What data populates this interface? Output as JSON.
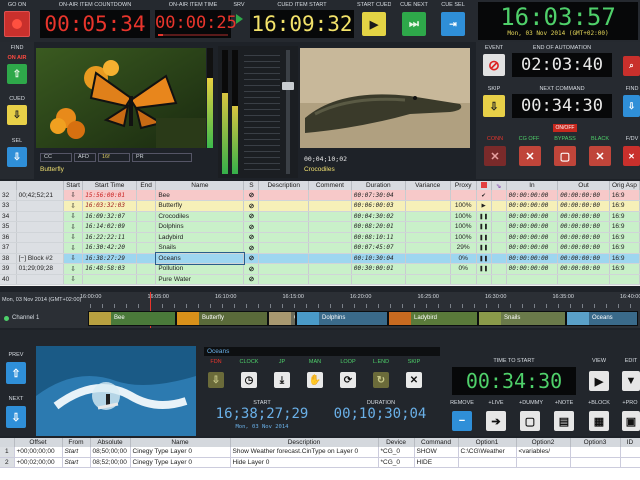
{
  "header": {
    "go_on_label": "GO ON",
    "on_air_countdown_label": "ON-AIR ITEM COUNTDOWN",
    "on_air_countdown_value": "00:05:34",
    "on_air_time_label": "ON-AIR ITEM TIME",
    "on_air_time_value": "00:00:25",
    "srv_label": "SRV",
    "cued_start_label": "CUED ITEM START",
    "cued_start_value": "16:09:32",
    "start_cued_label": "START CUED",
    "cue_next_label": "CUE NEXT",
    "cue_sel_label": "CUE SEL",
    "clock_value": "16:03:57",
    "clock_date": "Mon, 03 Nov 2014 (GMT+02:00)"
  },
  "left_panel": {
    "find_label": "FIND",
    "on_air_label": "ON AIR",
    "cued_label": "CUED",
    "sel_label": "SEL"
  },
  "preview": {
    "onair_caption": "Butterfly",
    "onair_tags": [
      "CC",
      "AFD",
      "16f",
      "PR"
    ],
    "cued_timecode": "00;04;10;02",
    "cued_caption": "Crocodiles"
  },
  "right_panel": {
    "event_label": "EVENT",
    "end_of_automation_label": "END OF AUTOMATION",
    "end_of_automation_value": "02:03:40",
    "skip_label": "SKIP",
    "next_command_label": "NEXT COMMAND",
    "next_command_value": "00:34:30",
    "on_off_label": "ON/OFF",
    "find_label": "FIND",
    "fdv_label": "F/DV",
    "keyers": [
      "CONN",
      "CG OFF",
      "BYPASS",
      "BLACK"
    ]
  },
  "playlist": {
    "columns": [
      "",
      "Start",
      "Start Time",
      "End",
      "Name",
      "S",
      "Description",
      "Comment",
      "Duration",
      "Variance",
      "Proxy",
      "",
      "",
      "In",
      "Out",
      "Orig Asp"
    ],
    "rows": [
      {
        "num": "32",
        "time": "00;42;52;21",
        "start": "⇩",
        "start_time": "15:56:00:01",
        "name": "Bee",
        "duration": "00:07:30:04",
        "variance": "",
        "proxy": "",
        "in": "00:00:00:00",
        "out": "00:00:00:00",
        "asp": "16:9"
      },
      {
        "num": "33",
        "time": "",
        "start": "⇩",
        "start_time": "16:03:32:03",
        "name": "Butterfly",
        "duration": "00:06:00:03",
        "variance": "",
        "proxy": "100%",
        "in": "00:00:00:00",
        "out": "00:00:00:00",
        "asp": "16:9"
      },
      {
        "num": "34",
        "time": "",
        "start": "⇩",
        "start_time": "16:09:32:07",
        "name": "Crocodiles",
        "duration": "00:04:30:02",
        "variance": "",
        "proxy": "100%",
        "in": "00:00:00:00",
        "out": "00:00:00:00",
        "asp": "16:9"
      },
      {
        "num": "35",
        "time": "",
        "start": "⇩",
        "start_time": "16:14:02:09",
        "name": "Dolphins",
        "duration": "00:08:20:01",
        "variance": "",
        "proxy": "100%",
        "in": "00:00:00:00",
        "out": "00:00:00:00",
        "asp": "16:9"
      },
      {
        "num": "36",
        "time": "",
        "start": "⇩",
        "start_time": "16:22:22:11",
        "name": "Ladybird",
        "duration": "00:08:10:11",
        "variance": "",
        "proxy": "100%",
        "in": "00:00:00:00",
        "out": "00:00:00:00",
        "asp": "16:9"
      },
      {
        "num": "37",
        "time": "",
        "start": "⇩",
        "start_time": "16:30:42:20",
        "name": "Snails",
        "duration": "00:07:45:07",
        "variance": "",
        "proxy": "29%",
        "in": "00:00:00:00",
        "out": "00:00:00:00",
        "asp": "16:9"
      },
      {
        "num": "38",
        "time": "[−] Block #2",
        "start": "⇩",
        "start_time": "16:38:27:29",
        "name": "Oceans",
        "duration": "00:10:30:04",
        "variance": "",
        "proxy": "0%",
        "in": "00:00:00:00",
        "out": "00:00:00:00",
        "asp": "16:9"
      },
      {
        "num": "39",
        "time": "01;29;09;28",
        "start": "⇩",
        "start_time": "16:48:58:03",
        "name": "Pollution",
        "duration": "00:30:00:01",
        "variance": "",
        "proxy": "0%",
        "in": "00:00:00:00",
        "out": "00:00:00:00",
        "asp": "16:9"
      },
      {
        "num": "40",
        "time": "",
        "start": "⇩",
        "start_time": "",
        "name": "Pure Water",
        "duration": "",
        "variance": "",
        "proxy": "",
        "in": "",
        "out": "",
        "asp": ""
      }
    ]
  },
  "timeline": {
    "date_label": "Mon, 03 Nov 2014 (GMT+02:00)",
    "ticks": [
      "16:00:00",
      "16:05:00",
      "16:10:00",
      "16:15:00",
      "16:20:00",
      "16:25:00",
      "16:30:00",
      "16:35:00",
      "16:40:00"
    ],
    "channel_label": "Channel 1",
    "clips": [
      "Bee",
      "Butterfly",
      "Croc",
      "Dolphins",
      "Ladybird",
      "Snails",
      "Oceans"
    ]
  },
  "cue_panel": {
    "prev_label": "PREV",
    "next_label": "NEXT",
    "item_name": "Oceans",
    "buttons": [
      "FDN",
      "CLOCK",
      "JP",
      "MAN",
      "LOOP",
      "L.END",
      "SKIP"
    ],
    "start_label": "START",
    "start_value": "16;38;27;29",
    "start_date": "Mon, 03 Nov 2014",
    "duration_label": "DURATION",
    "duration_value": "00;10;30;04",
    "time_to_start_label": "TIME TO START",
    "time_to_start_value": "00:34:30",
    "view_label": "VIEW",
    "edit_label": "EDIT",
    "remove_label": "REMOVE",
    "add_live_label": "+LIVE",
    "add_dummy_label": "+DUMMY",
    "add_note_label": "+NOTE",
    "add_block_label": "+BLOCK",
    "add_pro_label": "+PRO"
  },
  "secondary": {
    "columns": [
      "",
      "Offset",
      "From",
      "Absolute",
      "Name",
      "Description",
      "Device",
      "Command",
      "Option1",
      "Option2",
      "Option3",
      "ID"
    ],
    "rows": [
      {
        "num": "1",
        "offset": "+00;00;00;00",
        "from": "Start",
        "absolute": "08;50;00;00",
        "name": "Cinegy Type Layer 0",
        "description": "Show Weather forecast.CinType on Layer 0",
        "device": "*CG_0",
        "command": "SHOW",
        "option1": "C:\\CG\\Weather",
        "option2": "<variables/",
        "option3": "",
        "id": ""
      },
      {
        "num": "2",
        "offset": "+00;02;00;00",
        "from": "Start",
        "absolute": "08;52;00;00",
        "name": "Cinegy Type Layer 0",
        "description": "Hide Layer 0",
        "device": "*CG_0",
        "command": "HIDE",
        "option1": "",
        "option2": "",
        "option3": "",
        "id": ""
      }
    ]
  },
  "colors": {
    "accent_red": "#e8352c",
    "accent_green": "#2ea84a",
    "accent_yellow": "#e4d445",
    "accent_blue": "#2f8fd8",
    "highlight_row": "#7ec8e8"
  }
}
